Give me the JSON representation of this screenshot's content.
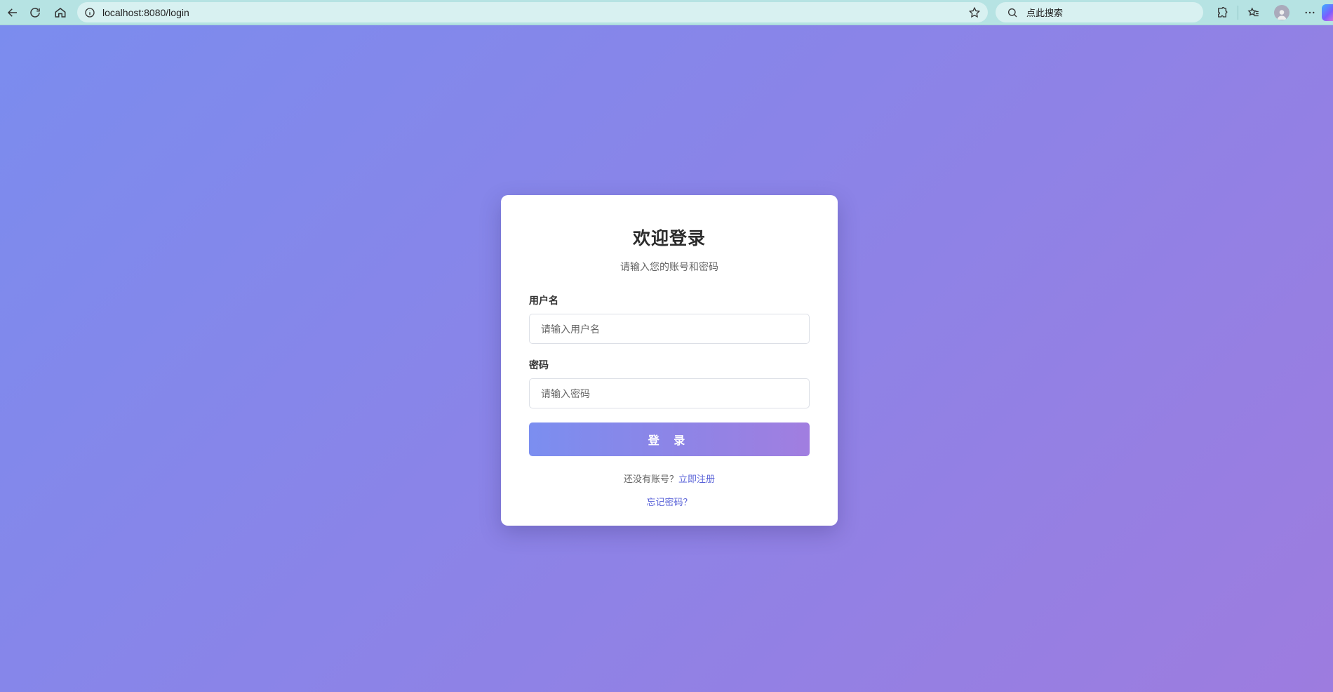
{
  "browser": {
    "url": "localhost:8080/login",
    "search_placeholder": "点此搜索"
  },
  "login": {
    "title": "欢迎登录",
    "subtitle": "请输入您的账号和密码",
    "username_label": "用户名",
    "username_placeholder": "请输入用户名",
    "username_value": "",
    "password_label": "密码",
    "password_placeholder": "请输入密码",
    "password_value": "",
    "submit_label": "登 录",
    "no_account_text": "还没有账号？",
    "register_link": "立即注册",
    "forgot_link": "忘记密码？"
  },
  "colors": {
    "chrome_bg": "#b6e3e3",
    "background_start": "#7b8cee",
    "background_end": "#9d7cdf",
    "link": "#5a63d8"
  }
}
